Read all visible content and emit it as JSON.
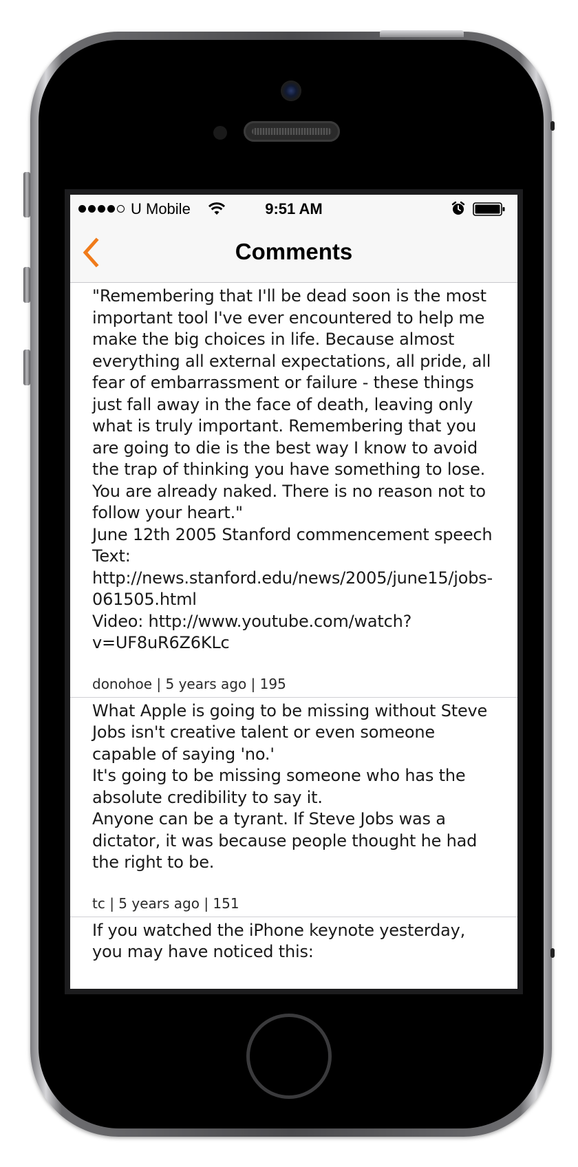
{
  "status_bar": {
    "signal_dots_filled": 4,
    "signal_dots_total": 5,
    "carrier": "U Mobile",
    "time": "9:51 AM",
    "icons": [
      "wifi-icon",
      "alarm-clock-icon",
      "battery-icon"
    ],
    "battery_level": 1.0
  },
  "nav": {
    "title": "Comments",
    "back_icon": "chevron-left-icon",
    "accent_color": "#f07b1a"
  },
  "comments": [
    {
      "text": "\"Remembering that I'll be dead soon is the most important tool I've ever encountered to help me make the big choices in life. Because almost everything all external expectations, all pride, all fear of embarrassment or failure - these things just fall away in the face of death, leaving only what is truly important. Remembering that you are going to die is the best way I know to avoid the trap of thinking you have something to lose. You are already naked. There is no reason not to follow your heart.\"\nJune 12th 2005 Stanford commencement speech\nText: http://news.stanford.edu/news/2005/june15/jobs-061505.html\nVideo: http://www.youtube.com/watch?v=UF8uR6Z6KLc",
      "meta": "donohoe | 5 years ago | 195"
    },
    {
      "text": "What Apple is going to be missing without Steve Jobs isn't creative talent or even someone capable of saying 'no.'\nIt's going to be missing someone who has the absolute credibility to say it.\nAnyone can be a tyrant. If Steve Jobs was a dictator, it was because people thought he had the right to be.",
      "meta": "tc | 5 years ago | 151"
    },
    {
      "text": "If you watched the iPhone keynote yesterday, you may have noticed this:",
      "meta": ""
    }
  ]
}
